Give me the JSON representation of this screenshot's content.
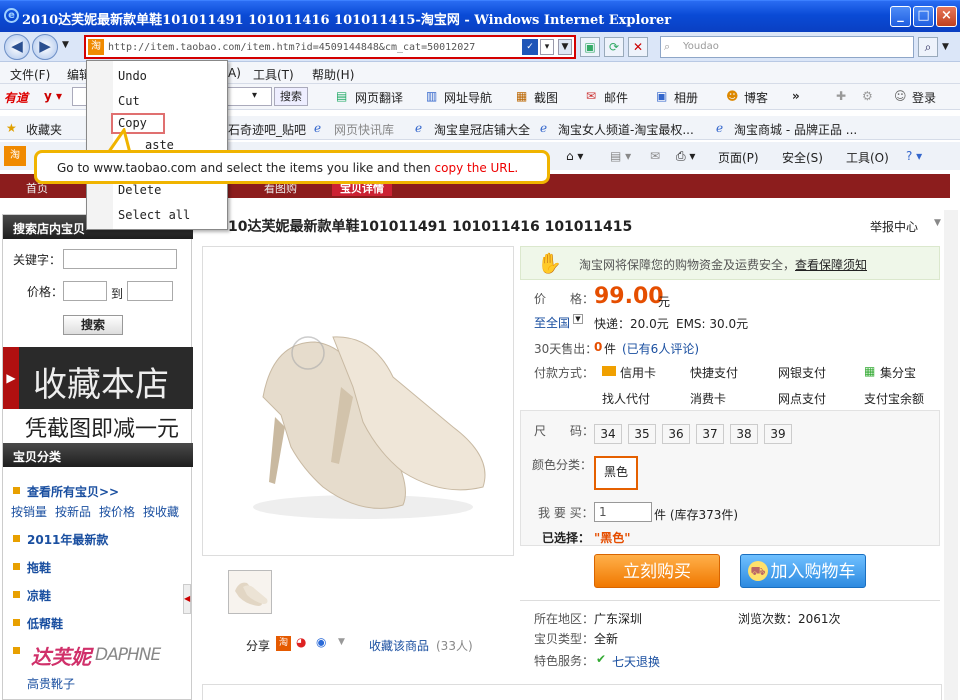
{
  "window": {
    "title": "2010达芙妮最新款单鞋101011491 101011416 101011415-淘宝网 - Windows Internet Explorer",
    "min": "_",
    "max": "□",
    "close": "×"
  },
  "address": {
    "url": "http://item.taobao.com/item.htm?id=4509144848&cm_cat=50012027",
    "search_placeholder": "Youdao"
  },
  "menu": {
    "file": "文件(F)",
    "edit": "编辑",
    "tools": "工具(T)",
    "help": "帮助(H)",
    "frag": "A)"
  },
  "youdao": {
    "logo": "有道",
    "search_btn": "搜索",
    "translate": "网页翻译",
    "nav": "网址导航",
    "screenshot": "截图",
    "mail": "邮件",
    "album": "相册",
    "blog": "博客",
    "login": "登录",
    "more": "»"
  },
  "favorites": {
    "label": "收藏夹",
    "f1": "石奇迹吧_贴吧",
    "f2": "网页快讯库",
    "f3": "淘宝皇冠店铺大全",
    "f4": "淘宝女人频道-淘宝最权...",
    "f5": "淘宝商城 - 品牌正品 ..."
  },
  "cmd": {
    "page": "页面(P)",
    "safety": "安全(S)",
    "tools": "工具(O)"
  },
  "context_menu": {
    "undo": "Undo",
    "cut": "Cut",
    "copy": "Copy",
    "paste": "aste",
    "delete": "Delete",
    "select_all": "Select all"
  },
  "callout": {
    "text": "Go to www.taobao.com and select the items you like and then ",
    "highlight": "copy the URL."
  },
  "tabs": {
    "t1": "首页",
    "t2": "看图购",
    "t3": "宝贝详情"
  },
  "left": {
    "search_title": "搜索店内宝贝",
    "keyword": "关键字：",
    "price": "价格：",
    "to": "到",
    "search_btn": "搜索",
    "banner_big": "收藏本店",
    "banner_small": "凭截图即减一元",
    "cat_title": "宝贝分类",
    "all": "查看所有宝贝>>",
    "sort1": "按销量",
    "sort2": "按新品",
    "sort3": "按价格",
    "sort4": "按收藏",
    "c1": "2011年最新款",
    "c2": "拖鞋",
    "c3": "凉鞋",
    "c4": "低帮鞋",
    "brand": "达芙妮",
    "brand_en": "DAPHNE",
    "sub": "高贵靴子"
  },
  "product": {
    "title": "10达芙妮最新款单鞋101011491 101011416 101011415",
    "report": "举报中心",
    "guarantee": "淘宝网将保障您的购物资金及运费安全，",
    "guarantee_link": "查看保障须知",
    "price_label": "价　　格：",
    "price": "99.00",
    "unit": "元",
    "ship_to": "至全国",
    "express": "快递：20.0元",
    "ems": "EMS: 30.0元",
    "sold_label": "30天售出：",
    "sold": "0",
    "sold_unit": "件",
    "reviews": "(已有6人评论)",
    "pay_label": "付款方式：",
    "p1": "信用卡",
    "p2": "快捷支付",
    "p3": "网银支付",
    "p4": "集分宝",
    "p5": "找人代付",
    "p6": "消费卡",
    "p7": "网点支付",
    "p8": "支付宝余额",
    "size_label": "尺　　码：",
    "sizes": [
      "34",
      "35",
      "36",
      "37",
      "38",
      "39"
    ],
    "color_label": "颜色分类：",
    "color": "黑色",
    "qty_label": "我 要 买：",
    "qty": "1",
    "stock": "件 (库存373件)",
    "selected_label": "已选择：",
    "selected": "\"黑色\"",
    "buy": "立刻购买",
    "cart": "加入购物车",
    "loc_label": "所在地区：",
    "loc": "广东深圳",
    "views": "浏览次数：2061次",
    "type_label": "宝贝类型：",
    "type": "全新",
    "service_label": "特色服务：",
    "service": "七天退换",
    "share": "分享",
    "collect": "收藏该商品",
    "collect_count": "(33人)"
  }
}
